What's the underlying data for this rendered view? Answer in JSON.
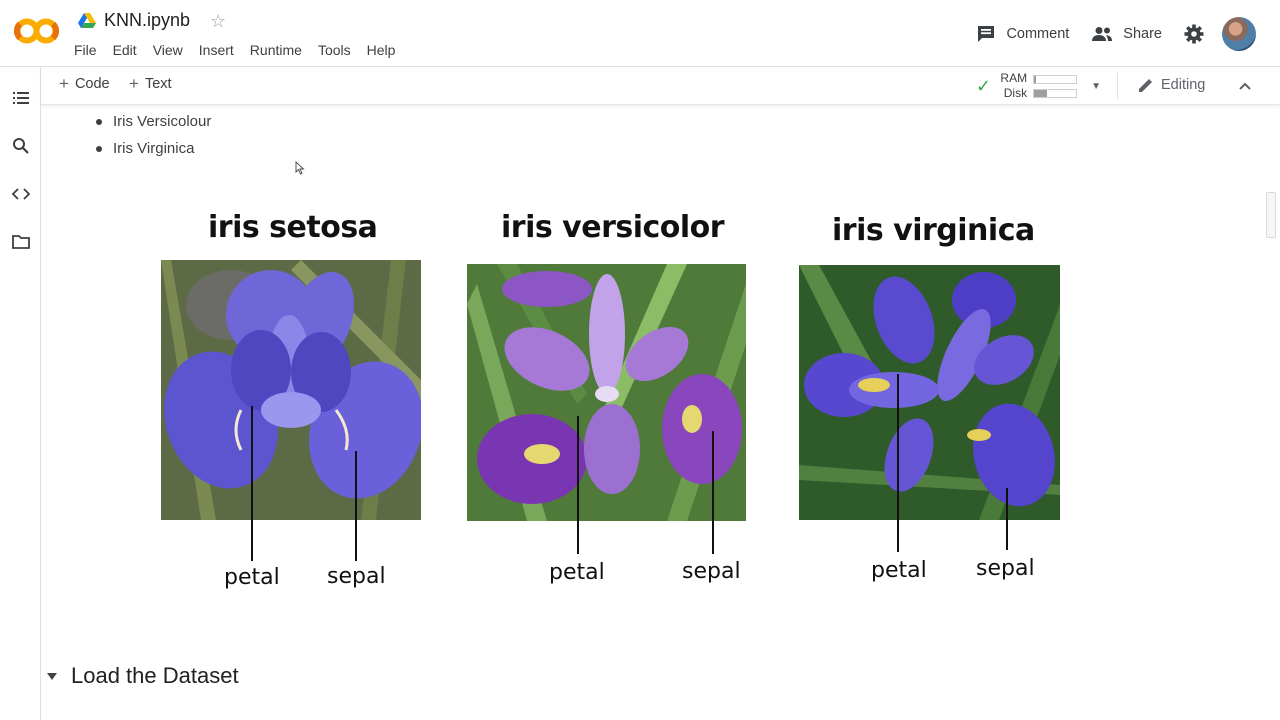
{
  "header": {
    "title": "KNN.ipynb",
    "menu": [
      "File",
      "Edit",
      "View",
      "Insert",
      "Runtime",
      "Tools",
      "Help"
    ],
    "comment_label": "Comment",
    "share_label": "Share"
  },
  "toolbar": {
    "code_label": "Code",
    "text_label": "Text",
    "ram_label": "RAM",
    "disk_label": "Disk",
    "ram_usage": 0.05,
    "disk_usage": 0.3,
    "editing_label": "Editing"
  },
  "content": {
    "bullets": [
      "Iris Versicolour",
      "Iris Virginica"
    ],
    "figure": {
      "titles": [
        "iris setosa",
        "iris versicolor",
        "iris virginica"
      ],
      "petal_label": "petal",
      "sepal_label": "sepal"
    },
    "section_title": "Load the Dataset"
  },
  "colors": {
    "logo_orange": "#f9ab00",
    "check_green": "#34a853",
    "petal_purple": "#6a5ad6"
  },
  "icons": [
    "colab-logo",
    "drive-icon",
    "star-icon",
    "comment-icon",
    "people-icon",
    "gear-icon",
    "toc-icon",
    "search-icon",
    "code-icon",
    "folder-icon",
    "check-icon",
    "pencil-icon",
    "chevron-up-icon",
    "caret-down-icon"
  ]
}
